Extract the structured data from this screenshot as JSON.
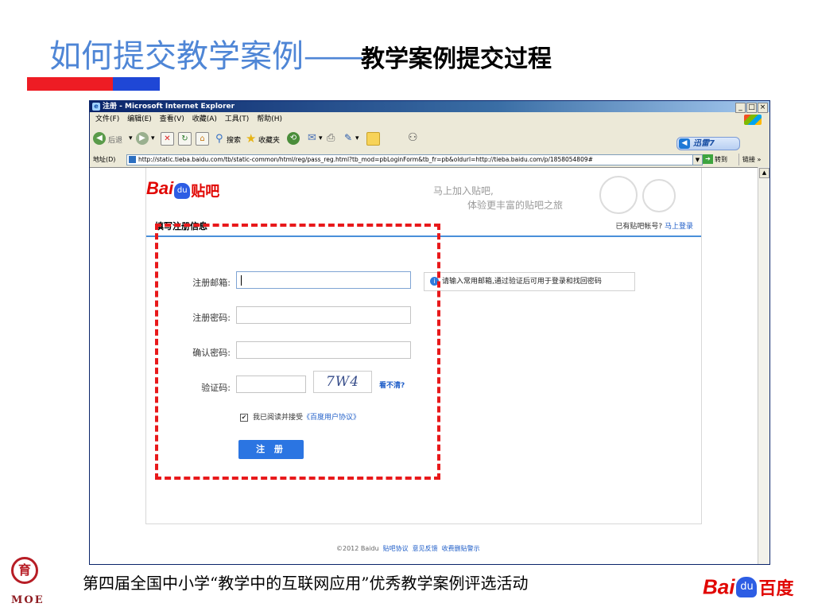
{
  "slide": {
    "title_part1": "如何提交教学案例",
    "title_dash": "——",
    "title_part2": "教学案例提交过程",
    "bottom_caption": "第四届全国中小学“教学中的互联网应用”优秀教学案例评选活动",
    "moe_emblem_text": "育",
    "moe_text": "MOE",
    "baidu_logo": {
      "bai": "Bai",
      "du": "du",
      "cn": "百度"
    },
    "accent_colors": {
      "title": "#4f86d6",
      "bar_red": "#ee1c24",
      "bar_blue": "#1f47d6",
      "dash": "#e8191b"
    }
  },
  "browser": {
    "title": "注册 - Microsoft Internet Explorer",
    "window_buttons": [
      "_",
      "□",
      "×"
    ],
    "menu": [
      "文件(F)",
      "编辑(E)",
      "查看(V)",
      "收藏(A)",
      "工具(T)",
      "帮助(H)"
    ],
    "toolbar": {
      "back": "后退",
      "search": "搜索",
      "favorites": "收藏夹",
      "xunlei": "迅雷7"
    },
    "address": {
      "label": "地址(D)",
      "url": "http://static.tieba.baidu.com/tb/static-common/html/reg/pass_reg.html?tb_mod=pbLoginForm&tb_fr=pb&oldurl=http://tieba.baidu.com/p/1858054809#",
      "go": "转到",
      "links": "链接"
    }
  },
  "page": {
    "logo": {
      "bai": "Bai",
      "du": "du",
      "tieba": "贴吧"
    },
    "slogan_line1": "马上加入贴吧,",
    "slogan_line2": "体验更丰富的贴吧之旅",
    "section_title": "填写注册信息",
    "have_account": "已有贴吧帐号?",
    "login_link": "马上登录",
    "form": {
      "email_label": "注册邮箱:",
      "password_label": "注册密码:",
      "confirm_label": "确认密码:",
      "captcha_label": "验证码:",
      "captcha_text": "7W4",
      "refresh_link": "看不清?",
      "email_tip": "请输入常用邮箱,通过验证后可用于登录和找回密码",
      "agree_checkbox_mark": "✔",
      "agree_text": "我已阅读并接受",
      "agreement_link": "《百度用户协议》",
      "submit": "注 册"
    },
    "footer": {
      "copyright": "©2012 Baidu",
      "links": [
        "贴吧协议",
        "意见反馈",
        "收费删贴警示"
      ]
    }
  }
}
